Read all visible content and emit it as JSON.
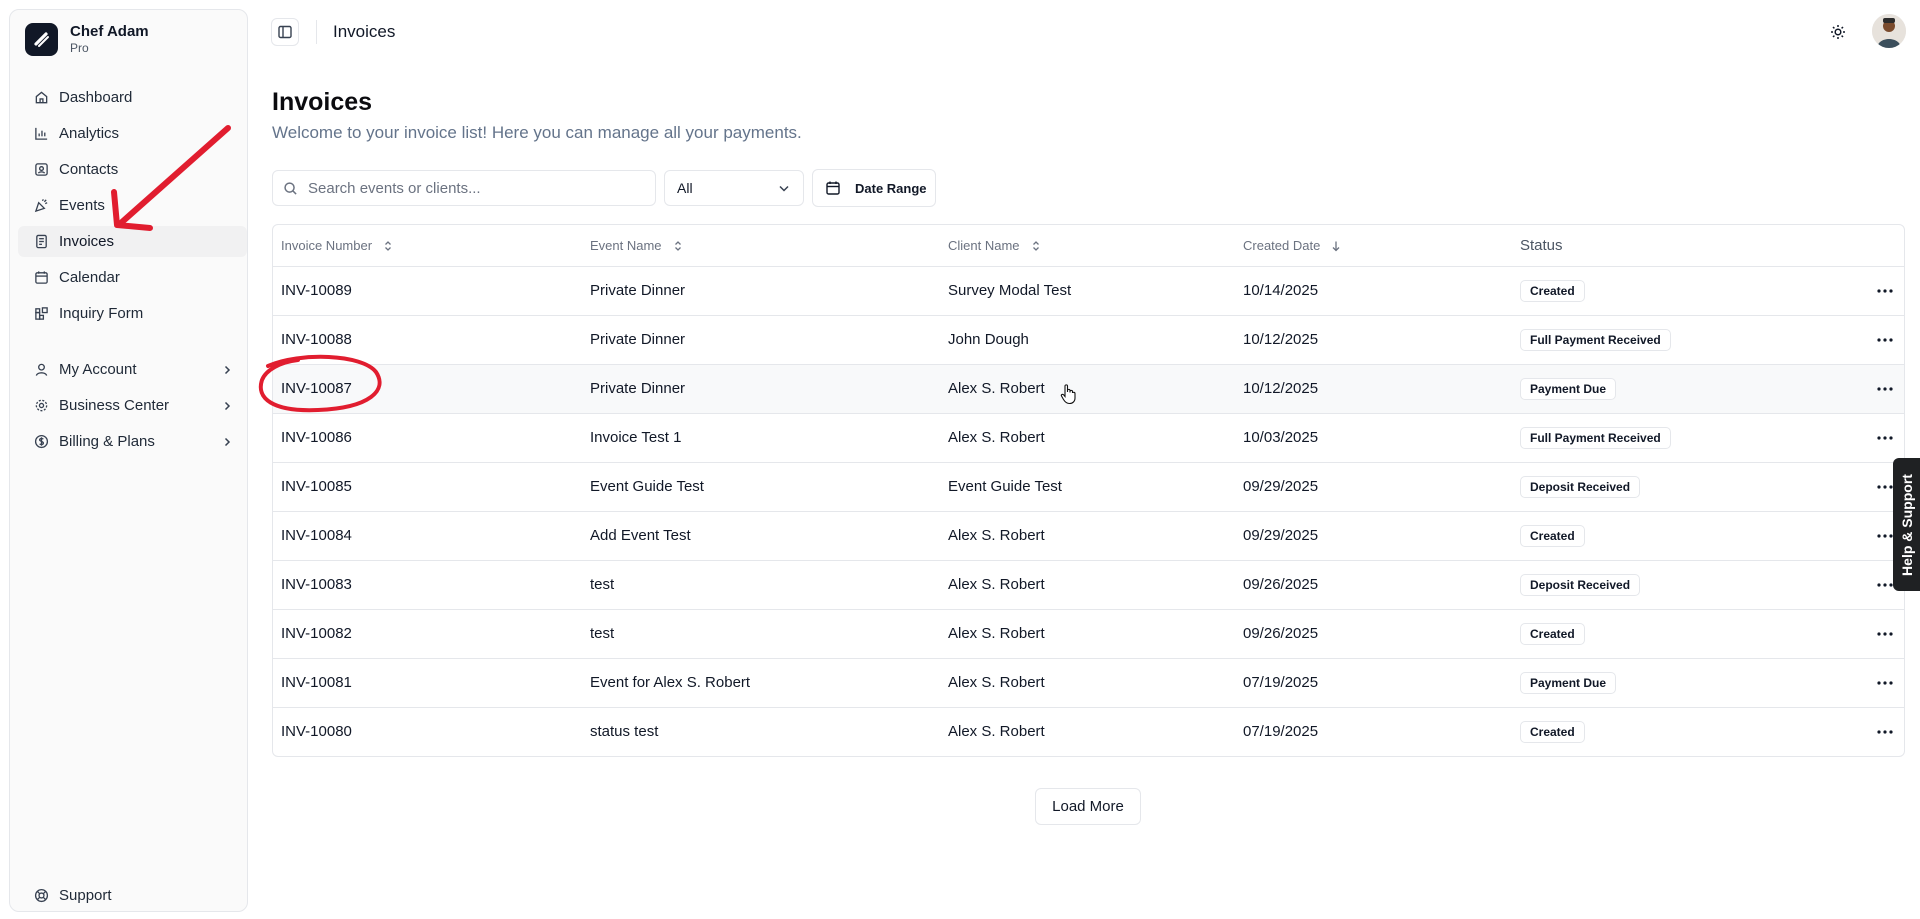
{
  "sidebar": {
    "brand_name": "Chef Adam",
    "brand_plan": "Pro",
    "items": [
      {
        "label": "Dashboard",
        "icon": "home-icon"
      },
      {
        "label": "Analytics",
        "icon": "bar-chart-icon"
      },
      {
        "label": "Contacts",
        "icon": "contact-card-icon"
      },
      {
        "label": "Events",
        "icon": "party-popper-icon"
      },
      {
        "label": "Invoices",
        "icon": "document-icon",
        "active": true
      },
      {
        "label": "Calendar",
        "icon": "calendar-icon"
      },
      {
        "label": "Inquiry Form",
        "icon": "form-blocks-icon"
      }
    ],
    "groups": [
      {
        "label": "My Account",
        "icon": "user-icon"
      },
      {
        "label": "Business Center",
        "icon": "gear-icon"
      },
      {
        "label": "Billing & Plans",
        "icon": "dollar-circle-icon"
      }
    ],
    "support_label": "Support"
  },
  "topbar": {
    "title": "Invoices"
  },
  "page": {
    "title": "Invoices",
    "subtitle": "Welcome to your invoice list! Here you can manage all your payments."
  },
  "filters": {
    "search_placeholder": "Search events or clients...",
    "status_selected": "All",
    "date_range_label": "Date Range"
  },
  "table": {
    "columns": {
      "invoice_number": "Invoice Number",
      "event_name": "Event Name",
      "client_name": "Client Name",
      "created_date": "Created Date",
      "status": "Status"
    },
    "rows": [
      {
        "invoice": "INV-10089",
        "event": "Private Dinner",
        "client": "Survey Modal Test",
        "date": "10/14/2025",
        "status": "Created"
      },
      {
        "invoice": "INV-10088",
        "event": "Private Dinner",
        "client": "John Dough",
        "date": "10/12/2025",
        "status": "Full Payment Received"
      },
      {
        "invoice": "INV-10087",
        "event": "Private Dinner",
        "client": "Alex S. Robert",
        "date": "10/12/2025",
        "status": "Payment Due"
      },
      {
        "invoice": "INV-10086",
        "event": "Invoice Test 1",
        "client": "Alex S. Robert",
        "date": "10/03/2025",
        "status": "Full Payment Received"
      },
      {
        "invoice": "INV-10085",
        "event": "Event Guide Test",
        "client": "Event Guide Test",
        "date": "09/29/2025",
        "status": "Deposit Received"
      },
      {
        "invoice": "INV-10084",
        "event": "Add Event Test",
        "client": "Alex S. Robert",
        "date": "09/29/2025",
        "status": "Created"
      },
      {
        "invoice": "INV-10083",
        "event": "test",
        "client": "Alex S. Robert",
        "date": "09/26/2025",
        "status": "Deposit Received"
      },
      {
        "invoice": "INV-10082",
        "event": "test",
        "client": "Alex S. Robert",
        "date": "09/26/2025",
        "status": "Created"
      },
      {
        "invoice": "INV-10081",
        "event": "Event for Alex S. Robert",
        "client": "Alex S. Robert",
        "date": "07/19/2025",
        "status": "Payment Due"
      },
      {
        "invoice": "INV-10080",
        "event": "status test",
        "client": "Alex S. Robert",
        "date": "07/19/2025",
        "status": "Created"
      }
    ]
  },
  "load_more_label": "Load More",
  "help_tab_label": "Help & Support",
  "colors": {
    "annotation": "#e11d2f",
    "primary": "#111827"
  }
}
